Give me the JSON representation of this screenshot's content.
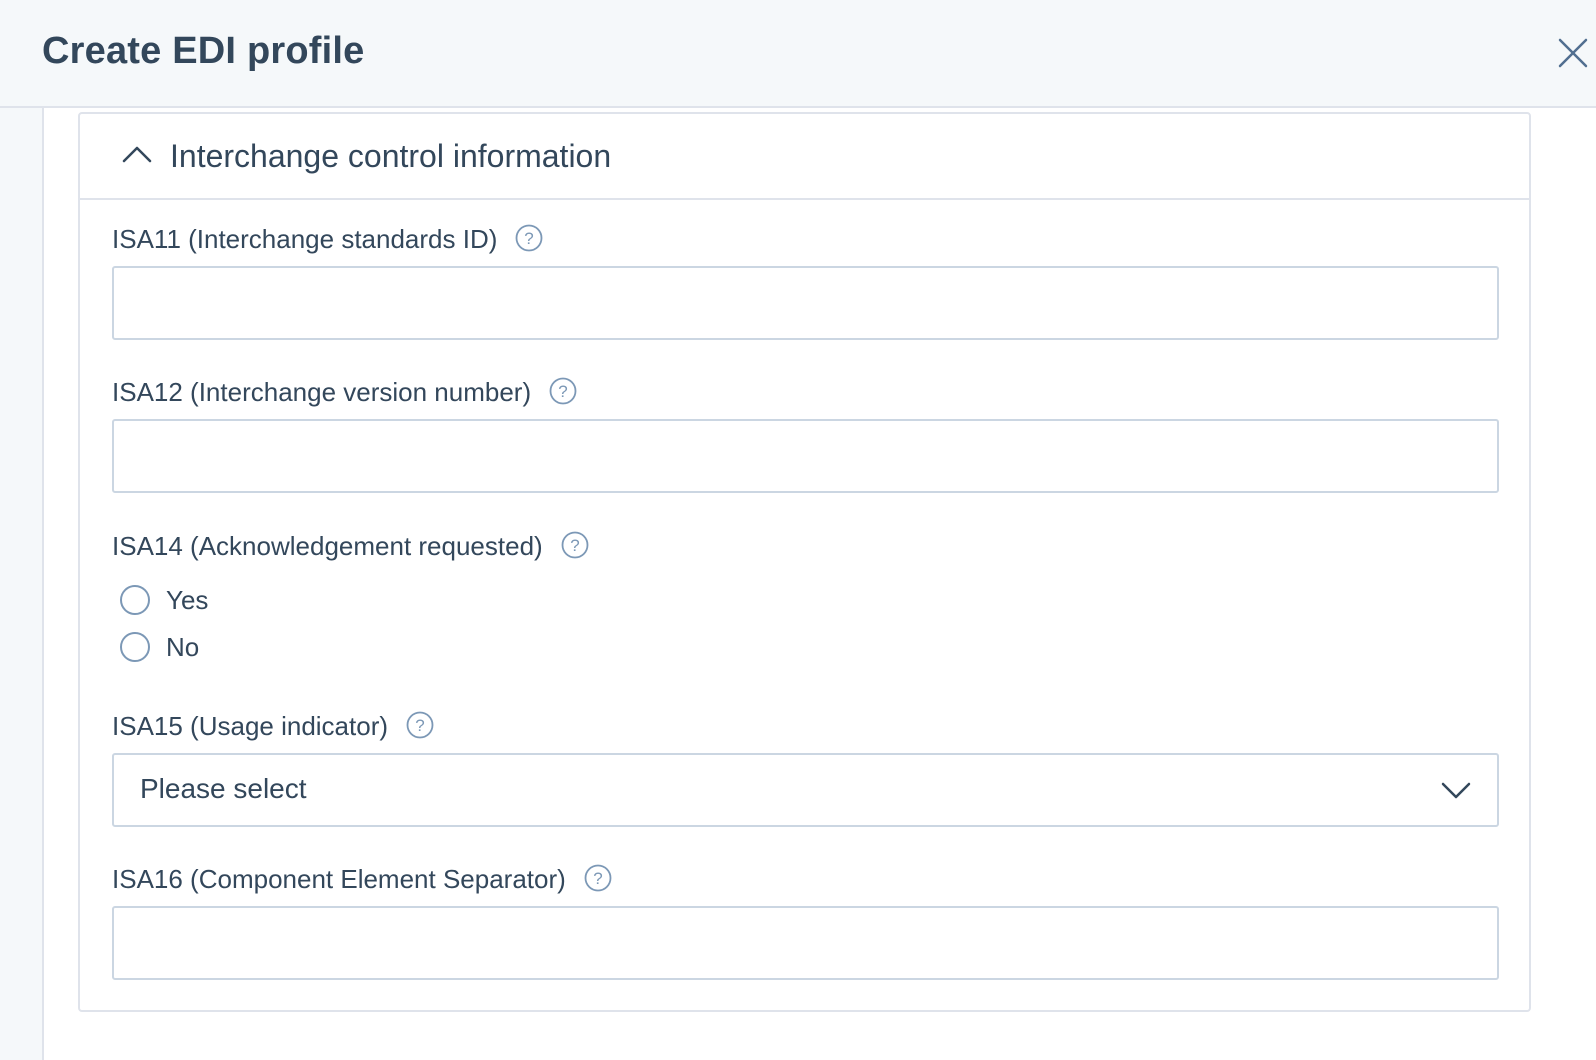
{
  "dialog": {
    "title": "Create EDI profile",
    "close_icon": "close-icon"
  },
  "section": {
    "title": "Interchange control information",
    "toggle_icon": "chevron-up-icon",
    "expanded": true
  },
  "fields": {
    "isa11": {
      "label": "ISA11 (Interchange standards ID)",
      "value": "",
      "help_icon": "help-icon"
    },
    "isa12": {
      "label": "ISA12 (Interchange version number)",
      "value": "",
      "help_icon": "help-icon"
    },
    "isa14": {
      "label": "ISA14 (Acknowledgement requested)",
      "help_icon": "help-icon",
      "options": [
        "Yes",
        "No"
      ],
      "selected": null
    },
    "isa15": {
      "label": "ISA15 (Usage indicator)",
      "help_icon": "help-icon",
      "selected_display": "Please select",
      "dropdown_icon": "chevron-down-icon"
    },
    "isa16": {
      "label": "ISA16 (Component Element Separator)",
      "value": "",
      "help_icon": "help-icon"
    }
  },
  "colors": {
    "text": "#33475b",
    "border": "#cbd6e2",
    "divider": "#dfe3eb",
    "background": "#f5f8fa",
    "icon": "#7c98b6"
  }
}
